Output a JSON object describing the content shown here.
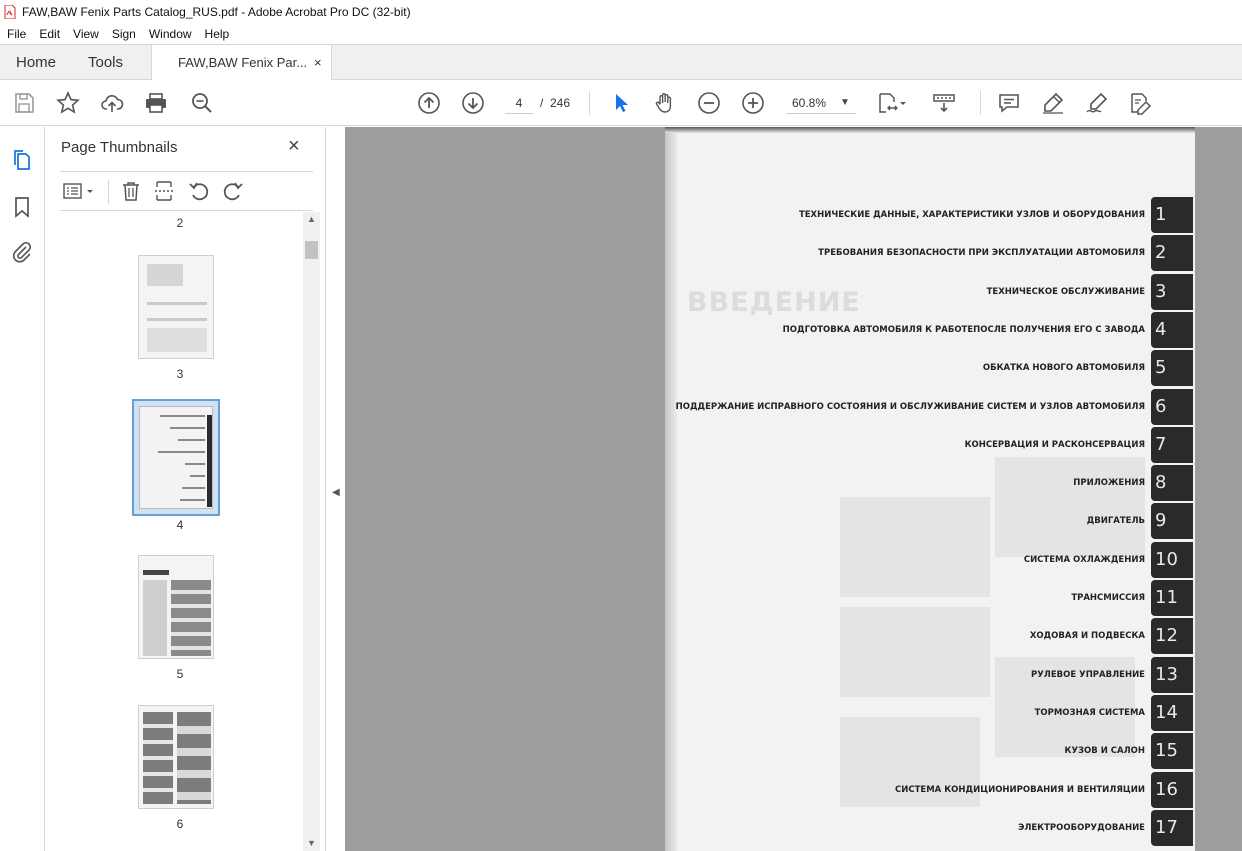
{
  "window": {
    "title": "FAW,BAW Fenix Parts Catalog_RUS.pdf - Adobe Acrobat Pro DC (32-bit)"
  },
  "menu": [
    "File",
    "Edit",
    "View",
    "Sign",
    "Window",
    "Help"
  ],
  "tabs": {
    "home": "Home",
    "tools": "Tools",
    "document": "FAW,BAW Fenix Par...",
    "close": "×"
  },
  "nav": {
    "current_page": "4",
    "separator": "/",
    "total_pages": "246"
  },
  "zoom": {
    "value": "60.8%"
  },
  "thumbnails": {
    "header": "Page Thumbnails",
    "close": "×",
    "pages": [
      {
        "label": "2"
      },
      {
        "label": "3"
      },
      {
        "label": "4",
        "selected": true
      },
      {
        "label": "5"
      },
      {
        "label": "6"
      }
    ]
  },
  "document": {
    "ghost_heading": "ВВЕДЕНИЕ",
    "sections": [
      {
        "title": "ТЕХНИЧЕСКИЕ ДАННЫЕ, ХАРАКТЕРИСТИКИ УЗЛОВ И ОБОРУДОВАНИЯ",
        "num": "1"
      },
      {
        "title": "ТРЕБОВАНИЯ БЕЗОПАСНОСТИ ПРИ ЭКСПЛУАТАЦИИ АВТОМОБИЛЯ",
        "num": "2"
      },
      {
        "title": "ТЕХНИЧЕСКОЕ ОБСЛУЖИВАНИЕ",
        "num": "3"
      },
      {
        "title": "ПОДГОТОВКА АВТОМОБИЛЯ К РАБОТЕПОСЛЕ ПОЛУЧЕНИЯ ЕГО С ЗАВОДА",
        "num": "4"
      },
      {
        "title": "ОБКАТКА НОВОГО АВТОМОБИЛЯ",
        "num": "5"
      },
      {
        "title": "ПОДДЕРЖАНИЕ ИСПРАВНОГО СОСТОЯНИЯ И ОБСЛУЖИВАНИЕ СИСТЕМ И УЗЛОВ АВТОМОБИЛЯ",
        "num": "6"
      },
      {
        "title": "КОНСЕРВАЦИЯ И РАСКОНСЕРВАЦИЯ",
        "num": "7"
      },
      {
        "title": "ПРИЛОЖЕНИЯ",
        "num": "8"
      },
      {
        "title": "ДВИГАТЕЛЬ",
        "num": "9"
      },
      {
        "title": "СИСТЕМА ОХЛАЖДЕНИЯ",
        "num": "10"
      },
      {
        "title": "ТРАНСМИССИЯ",
        "num": "11"
      },
      {
        "title": "ХОДОВАЯ И ПОДВЕСКА",
        "num": "12"
      },
      {
        "title": "РУЛЕВОЕ УПРАВЛЕНИЕ",
        "num": "13"
      },
      {
        "title": "ТОРМОЗНАЯ СИСТЕМА",
        "num": "14"
      },
      {
        "title": "КУЗОВ И САЛОН",
        "num": "15"
      },
      {
        "title": "СИСТЕМА КОНДИЦИОНИРОВАНИЯ И ВЕНТИЛЯЦИИ",
        "num": "16"
      },
      {
        "title": "ЭЛЕКТРООБОРУДОВАНИЕ",
        "num": "17"
      }
    ]
  },
  "colors": {
    "accent": "#1473e6",
    "toolbar_bg": "#ffffff",
    "canvas_bg": "#9d9d9d",
    "pdf_red": "#d9252a"
  }
}
